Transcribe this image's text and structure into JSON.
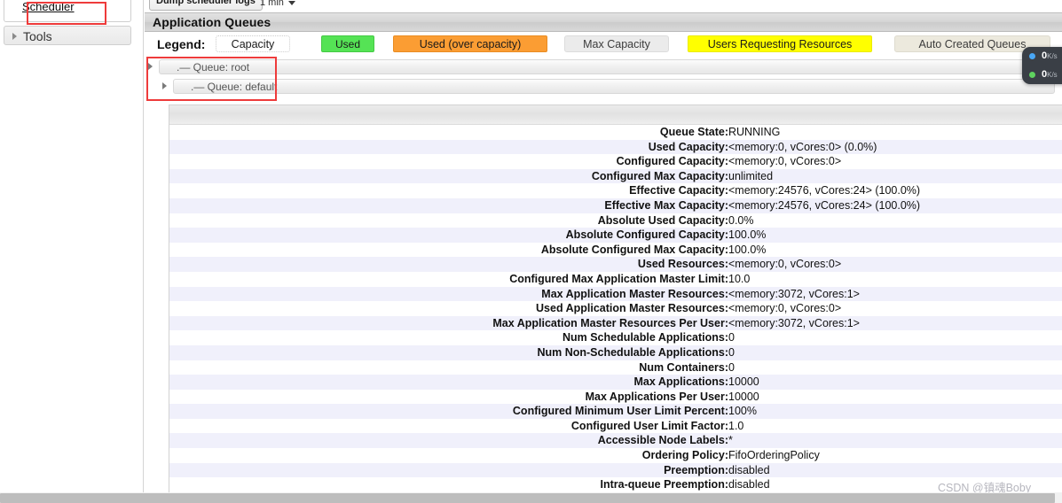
{
  "sidebar": {
    "scheduler_link": "Scheduler",
    "tools_label": "Tools"
  },
  "toolbar": {
    "dump_button": "Dump scheduler logs",
    "refresh_interval": "1 min"
  },
  "panel": {
    "title": "Application Queues"
  },
  "legend": {
    "label": "Legend:",
    "chips": [
      {
        "name": "capacity",
        "label": "Capacity",
        "color": "#ffffff"
      },
      {
        "name": "used",
        "label": "Used",
        "color": "#55e355"
      },
      {
        "name": "used-over-capacity",
        "label": "Used (over capacity)",
        "color": "#fb9d33"
      },
      {
        "name": "max-capacity",
        "label": "Max Capacity",
        "color": "#ebebeb"
      },
      {
        "name": "users-requesting-resources",
        "label": "Users Requesting Resources",
        "color": "#ffff00"
      },
      {
        "name": "auto-created-queues",
        "label": "Auto Created Queues",
        "color": "#ece9dd"
      }
    ]
  },
  "queue_tree": {
    "root": ".— Queue: root",
    "default": ".— Queue: default",
    "dash": ".—"
  },
  "queue_details": {
    "rows": [
      {
        "key": "Queue State:",
        "value": "RUNNING"
      },
      {
        "key": "Used Capacity:",
        "value": "<memory:0, vCores:0> (0.0%)"
      },
      {
        "key": "Configured Capacity:",
        "value": "<memory:0, vCores:0>"
      },
      {
        "key": "Configured Max Capacity:",
        "value": "unlimited"
      },
      {
        "key": "Effective Capacity:",
        "value": "<memory:24576, vCores:24> (100.0%)"
      },
      {
        "key": "Effective Max Capacity:",
        "value": "<memory:24576, vCores:24> (100.0%)"
      },
      {
        "key": "Absolute Used Capacity:",
        "value": "0.0%"
      },
      {
        "key": "Absolute Configured Capacity:",
        "value": "100.0%"
      },
      {
        "key": "Absolute Configured Max Capacity:",
        "value": "100.0%"
      },
      {
        "key": "Used Resources:",
        "value": "<memory:0, vCores:0>"
      },
      {
        "key": "Configured Max Application Master Limit:",
        "value": "10.0"
      },
      {
        "key": "Max Application Master Resources:",
        "value": "<memory:3072, vCores:1>"
      },
      {
        "key": "Used Application Master Resources:",
        "value": "<memory:0, vCores:0>"
      },
      {
        "key": "Max Application Master Resources Per User:",
        "value": "<memory:3072, vCores:1>"
      },
      {
        "key": "Num Schedulable Applications:",
        "value": "0"
      },
      {
        "key": "Num Non-Schedulable Applications:",
        "value": "0"
      },
      {
        "key": "Num Containers:",
        "value": "0"
      },
      {
        "key": "Max Applications:",
        "value": "10000"
      },
      {
        "key": "Max Applications Per User:",
        "value": "10000"
      },
      {
        "key": "Configured Minimum User Limit Percent:",
        "value": "100%"
      },
      {
        "key": "Configured User Limit Factor:",
        "value": "1.0"
      },
      {
        "key": "Accessible Node Labels:",
        "value": "*"
      },
      {
        "key": "Ordering Policy:",
        "value": "FifoOrderingPolicy"
      },
      {
        "key": "Preemption:",
        "value": "disabled"
      },
      {
        "key": "Intra-queue Preemption:",
        "value": "disabled"
      }
    ]
  },
  "net_widget": {
    "upload": "0",
    "upload_unit": "K/s",
    "download": "0",
    "download_unit": "K/s"
  },
  "watermark": "CSDN @镇魂Boby"
}
